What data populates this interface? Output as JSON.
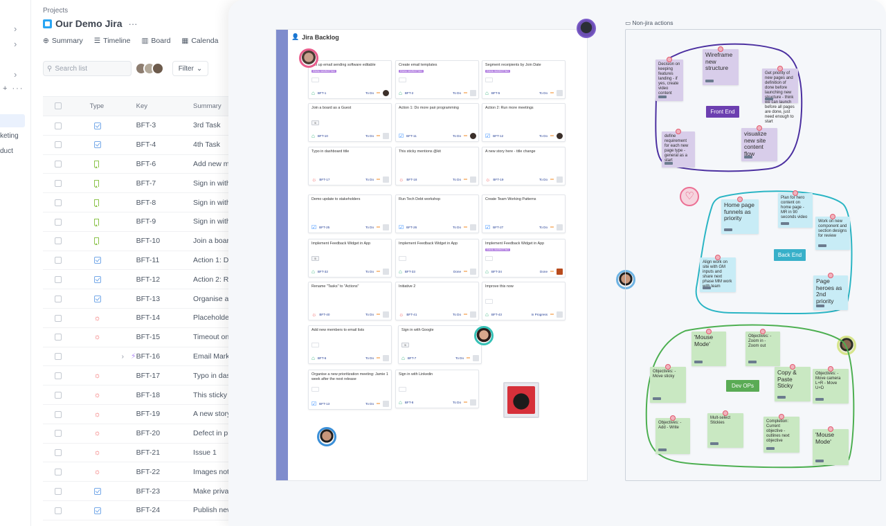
{
  "sidebar": {
    "items": [
      "keting",
      "duct"
    ]
  },
  "project": {
    "breadcrumb": "Projects",
    "title": "Our Demo Jira",
    "more": "···",
    "tabs": [
      "Summary",
      "Timeline",
      "Board",
      "Calenda"
    ]
  },
  "toolbar": {
    "search_placeholder": "Search list",
    "filter_label": "Filter"
  },
  "table": {
    "headers": [
      "Type",
      "Key",
      "Summary"
    ],
    "rows": [
      {
        "type": "task",
        "key": "BFT-3",
        "summary": "3rd Task"
      },
      {
        "type": "task",
        "key": "BFT-4",
        "summary": "4th Task"
      },
      {
        "type": "story",
        "key": "BFT-6",
        "summary": "Add new mer"
      },
      {
        "type": "story",
        "key": "BFT-7",
        "summary": "Sign in with G"
      },
      {
        "type": "story",
        "key": "BFT-8",
        "summary": "Sign in with L"
      },
      {
        "type": "story",
        "key": "BFT-9",
        "summary": "Sign in with e"
      },
      {
        "type": "story",
        "key": "BFT-10",
        "summary": "Join a board"
      },
      {
        "type": "task",
        "key": "BFT-11",
        "summary": "Action 1: Do r"
      },
      {
        "type": "task",
        "key": "BFT-12",
        "summary": "Action 2: Run"
      },
      {
        "type": "task",
        "key": "BFT-13",
        "summary": "Organise a ne"
      },
      {
        "type": "bug",
        "key": "BFT-14",
        "summary": "Placeholder"
      },
      {
        "type": "bug",
        "key": "BFT-15",
        "summary": "Timeout on c"
      },
      {
        "type": "epic",
        "key": "BFT-16",
        "summary": "Email Market"
      },
      {
        "type": "bug",
        "key": "BFT-17",
        "summary": "Typo in dash"
      },
      {
        "type": "bug",
        "key": "BFT-18",
        "summary": "This sticky m"
      },
      {
        "type": "bug",
        "key": "BFT-19",
        "summary": "A new story"
      },
      {
        "type": "bug",
        "key": "BFT-20",
        "summary": "Defect in pro"
      },
      {
        "type": "bug",
        "key": "BFT-21",
        "summary": "Issue 1"
      },
      {
        "type": "bug",
        "key": "BFT-22",
        "summary": "Images not c"
      },
      {
        "type": "task",
        "key": "BFT-23",
        "summary": "Make private"
      },
      {
        "type": "task",
        "key": "BFT-24",
        "summary": "Publish new"
      }
    ]
  },
  "backlog": {
    "title": "Jira Backlog",
    "cards": [
      {
        "title": "Set up email sending software editable",
        "tag": "EMAIL MARKETING",
        "type": "story",
        "key": "BFT-1",
        "status": "To Do",
        "assignee": "u1",
        "points": ""
      },
      {
        "title": "Create email templates",
        "tag": "EMAIL MARKETING",
        "type": "story",
        "key": "BFT-2",
        "status": "To Do",
        "assignee": "none",
        "points": ""
      },
      {
        "title": "Segment receipients by Join Date",
        "tag": "EMAIL MARKETING",
        "type": "story",
        "key": "BFT-5",
        "status": "To Do",
        "assignee": "none",
        "points": ""
      },
      {
        "title": "Join a board as a Guest",
        "tag": "",
        "type": "story",
        "key": "BFT-10",
        "status": "To Do",
        "assignee": "none",
        "points": "5"
      },
      {
        "title": "Action 1: Do more pair programming",
        "tag": "",
        "type": "task",
        "key": "BFT-11",
        "status": "To Do",
        "assignee": "u1",
        "points": ""
      },
      {
        "title": "Action 2: Run more meetings",
        "tag": "",
        "type": "task",
        "key": "BFT-12",
        "status": "To Do",
        "assignee": "u1",
        "points": ""
      },
      {
        "title": "Typo in dashboard title",
        "tag": "",
        "type": "bug",
        "key": "BFT-17",
        "status": "To Do",
        "assignee": "none",
        "points": ""
      },
      {
        "title": "This sticky mentions @kit",
        "tag": "",
        "type": "bug",
        "key": "BFT-18",
        "status": "To Do",
        "assignee": "none",
        "points": ""
      },
      {
        "title": "A new story here - title change",
        "tag": "",
        "type": "bug",
        "key": "BFT-19",
        "status": "To Do",
        "assignee": "none",
        "points": ""
      },
      {
        "title": "Demo update to stakeholders",
        "tag": "",
        "type": "task",
        "key": "BFT-25",
        "status": "To Do",
        "assignee": "none",
        "points": ""
      },
      {
        "title": "Run Tech Debt workshop",
        "tag": "",
        "type": "task",
        "key": "BFT-26",
        "status": "To Do",
        "assignee": "none",
        "points": ""
      },
      {
        "title": "Create Team Working Patterns",
        "tag": "",
        "type": "task",
        "key": "BFT-27",
        "status": "To Do",
        "assignee": "none",
        "points": ""
      },
      {
        "title": "Implement Feedback Widget in App",
        "tag": "",
        "type": "story",
        "key": "BFT-32",
        "status": "To Do",
        "assignee": "none",
        "points": "5"
      },
      {
        "title": "Implement Feedback Widget in App",
        "tag": "",
        "type": "story",
        "key": "BFT-33",
        "status": "Done",
        "assignee": "none",
        "points": ""
      },
      {
        "title": "Implement Feedback Widget in App",
        "tag": "EMAIL MARKETING",
        "type": "story",
        "key": "BFT-34",
        "status": "Done",
        "assignee": "u2",
        "points": ""
      },
      {
        "title": "Rename \"Tasks\" to \"Actions\"",
        "tag": "",
        "type": "bug",
        "key": "BFT-40",
        "status": "To Do",
        "assignee": "none",
        "points": ""
      },
      {
        "title": "Initiative 2",
        "tag": "",
        "type": "bug",
        "key": "BFT-41",
        "status": "To Do",
        "assignee": "none",
        "points": ""
      },
      {
        "title": "Improve this now",
        "tag": "",
        "type": "story",
        "key": "BFT-43",
        "status": "In Progress",
        "assignee": "none",
        "points": ""
      },
      {
        "title": "Add new members to email lists",
        "tag": "",
        "type": "story",
        "key": "BFT-6",
        "status": "To Do",
        "assignee": "none",
        "points": ""
      },
      {
        "title": "Sign in with Google",
        "tag": "",
        "type": "story",
        "key": "BFT-7",
        "status": "To Do",
        "assignee": "none",
        "points": "5"
      },
      {
        "title": "Organise a new prioritization meeting: Jamie 1 week after the next release",
        "tag": "",
        "type": "task",
        "key": "BFT-13",
        "status": "To Do",
        "assignee": "none",
        "points": ""
      },
      {
        "title": "Sign in with Linkedin",
        "tag": "",
        "type": "story",
        "key": "BFT-8",
        "status": "To Do",
        "assignee": "none",
        "points": ""
      }
    ]
  },
  "non_jira": {
    "label": "Non-jira actions",
    "groups": [
      {
        "label": "Front End",
        "color": "#6c3fb0"
      },
      {
        "label": "Back End",
        "color": "#38b0c9"
      },
      {
        "label": "Dev OPs",
        "color": "#5aab55"
      }
    ],
    "stickies": [
      {
        "text": "Decision on keeping features landing - if yes, create video content",
        "color": "purple",
        "big": false
      },
      {
        "text": "Wireframe new structure",
        "color": "purple",
        "big": true
      },
      {
        "text": "Get priority of new pages and definition of done before launching new structure - think we can launch before all pages are done, just need enough to start",
        "color": "purple",
        "big": false
      },
      {
        "text": "define requirement for each new page type - general as a start",
        "color": "purple",
        "big": false
      },
      {
        "text": "visualize new site content flow",
        "color": "purple",
        "big": true
      },
      {
        "text": "Home page funnels as priority",
        "color": "blue",
        "big": true
      },
      {
        "text": "Plan for hero content on home page - MR in 90 seconds video",
        "color": "blue",
        "big": false
      },
      {
        "text": "Work on new component and section designs for review",
        "color": "blue",
        "big": false
      },
      {
        "text": "Align work on site with GM inputs and share next phase MM work with team",
        "color": "blue",
        "big": false
      },
      {
        "text": "Page heroes as 2nd priority",
        "color": "blue",
        "big": true
      },
      {
        "text": "'Mouse Mode'",
        "color": "green",
        "big": true
      },
      {
        "text": "Objectives: - Zoom in - Zoom out",
        "color": "green",
        "big": false
      },
      {
        "text": "Objectives: - Move sticky",
        "color": "green",
        "big": false
      },
      {
        "text": "Copy & Paste Sticky",
        "color": "green",
        "big": true
      },
      {
        "text": "Objectives: - Move camera L+R - Move U+D",
        "color": "green",
        "big": false
      },
      {
        "text": "Objectives: - Add - Write",
        "color": "green",
        "big": false
      },
      {
        "text": "Mult-select Stickies",
        "color": "green",
        "big": false
      },
      {
        "text": "Completion: Current objective - outlines next objective",
        "color": "green",
        "big": false
      },
      {
        "text": "'Mouse Mode'",
        "color": "green",
        "big": true
      }
    ]
  }
}
